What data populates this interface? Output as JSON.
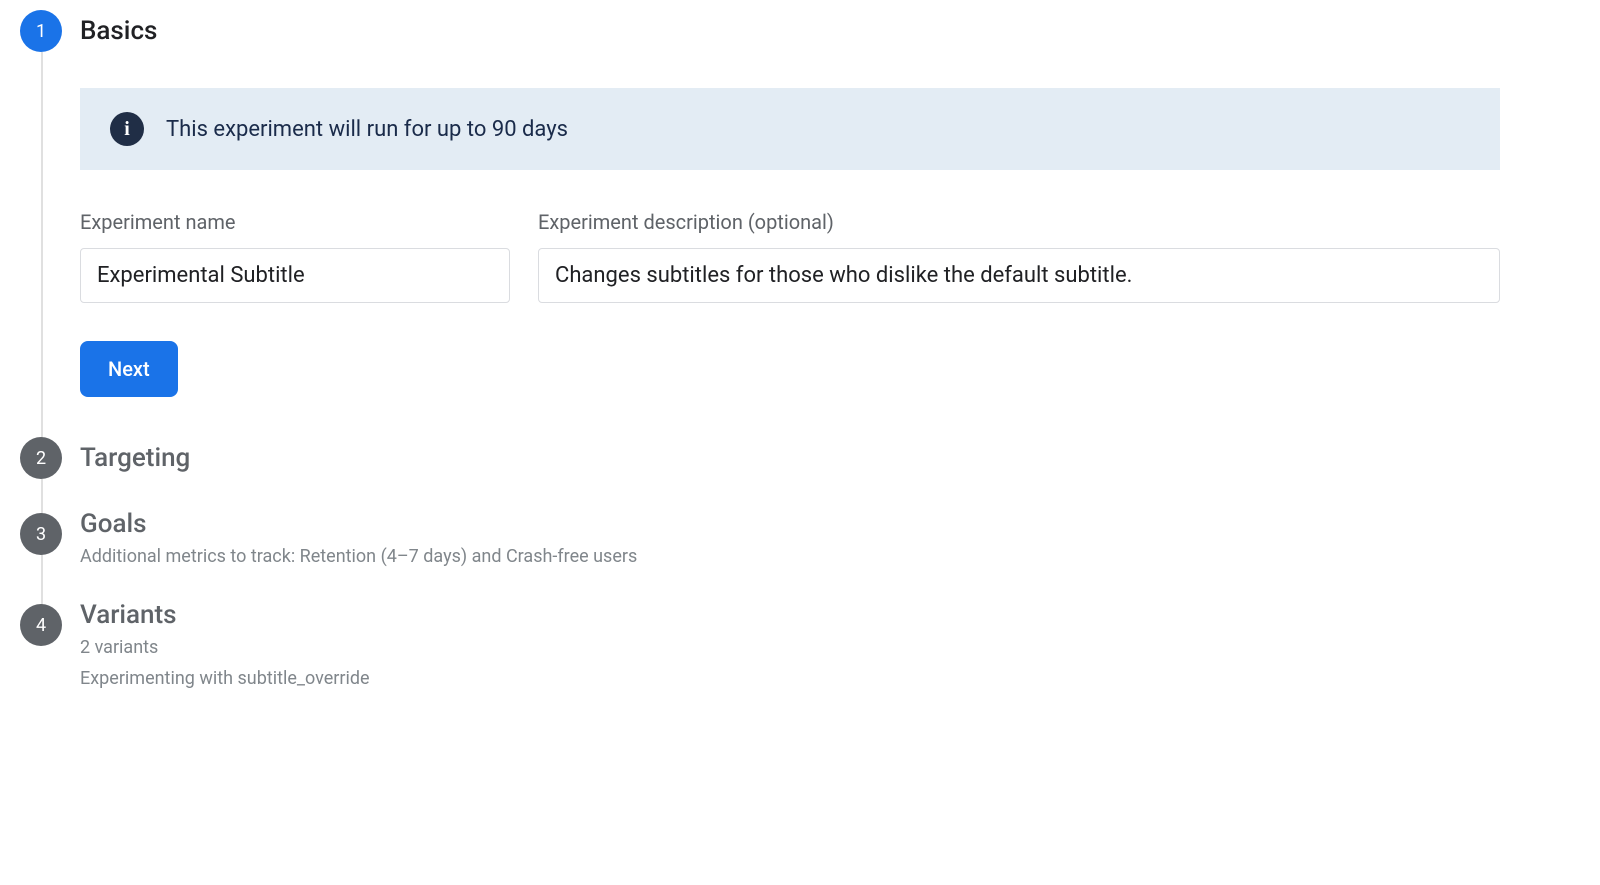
{
  "steps": {
    "basics": {
      "number": "1",
      "title": "Basics",
      "banner_text": "This experiment will run for up to 90 days",
      "name_label": "Experiment name",
      "name_value": "Experimental Subtitle",
      "description_label": "Experiment description (optional)",
      "description_value": "Changes subtitles for those who dislike the default subtitle.",
      "next_button": "Next"
    },
    "targeting": {
      "number": "2",
      "title": "Targeting"
    },
    "goals": {
      "number": "3",
      "title": "Goals",
      "subtitle": "Additional metrics to track: Retention (4–7 days) and Crash-free users"
    },
    "variants": {
      "number": "4",
      "title": "Variants",
      "subtitle_line1": "2 variants",
      "subtitle_line2": "Experimenting with subtitle_override"
    }
  }
}
